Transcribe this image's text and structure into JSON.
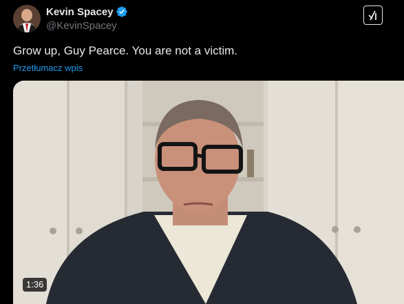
{
  "tweet": {
    "author": {
      "display_name": "Kevin Spacey",
      "handle": "@KevinSpacey",
      "verified": true
    },
    "text": "Grow up, Guy Pearce. You are not a victim.",
    "translate_label": "Przetłumacz wpis",
    "media": {
      "type": "video",
      "duration": "1:36"
    },
    "grok_icon": "grok-icon"
  },
  "colors": {
    "background": "#000000",
    "text_primary": "#e7e9ea",
    "text_secondary": "#71767b",
    "link": "#1d9bf0",
    "verified_badge": "#1d9bf0"
  }
}
